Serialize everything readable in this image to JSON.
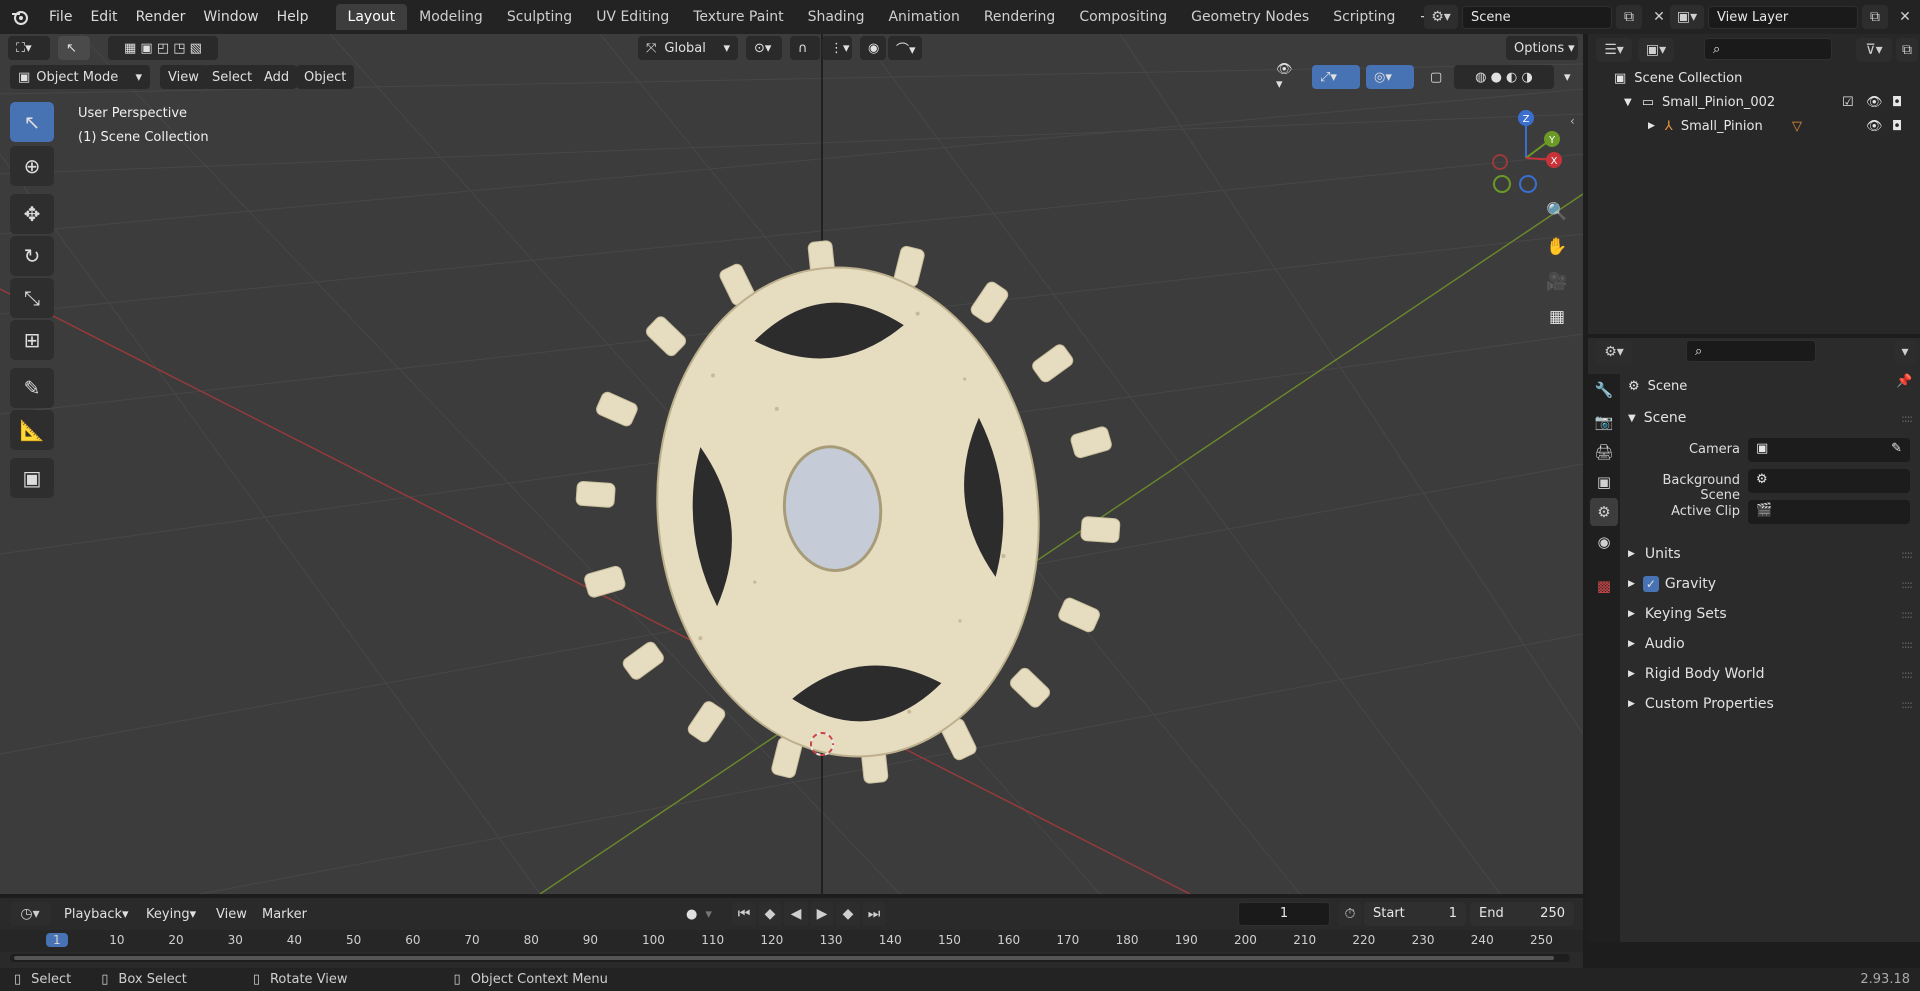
{
  "menu": {
    "logo_icon": "blender-icon",
    "items": [
      "File",
      "Edit",
      "Render",
      "Window",
      "Help"
    ]
  },
  "workspaces": {
    "tabs": [
      "Layout",
      "Modeling",
      "Sculpting",
      "UV Editing",
      "Texture Paint",
      "Shading",
      "Animation",
      "Rendering",
      "Compositing",
      "Geometry Nodes",
      "Scripting"
    ],
    "active": "Layout",
    "add_label": "+"
  },
  "scene_selector": {
    "value": "Scene"
  },
  "view_layer_selector": {
    "value": "View Layer"
  },
  "viewport_header": {
    "mode": "Object Mode",
    "menus": [
      "View",
      "Select",
      "Add",
      "Object"
    ],
    "orientation": "Global",
    "options_label": "Options"
  },
  "viewport": {
    "perspective_label": "User Perspective",
    "collection_label": "(1) Scene Collection",
    "gizmo_axes": [
      "Z",
      "Y",
      "X"
    ],
    "colors": {
      "background": "#3c3c3c",
      "grid": "#474747",
      "x_axis": "#9a3a3a",
      "y_axis": "#6b8a2a",
      "gear_body": "#e6dcc0",
      "gear_hub": "#c6cbd8"
    }
  },
  "outliner": {
    "root": "Scene Collection",
    "items": [
      {
        "name": "Small_Pinion_002",
        "level": 1
      },
      {
        "name": "Small_Pinion",
        "level": 2
      }
    ]
  },
  "properties": {
    "context_label": "Scene",
    "panel_title": "Scene",
    "fields": [
      {
        "label": "Camera"
      },
      {
        "label": "Background Scene"
      },
      {
        "label": "Active Clip"
      }
    ],
    "subpanels": [
      "Units",
      "Gravity",
      "Keying Sets",
      "Audio",
      "Rigid Body World",
      "Custom Properties"
    ],
    "gravity_checked": true
  },
  "timeline": {
    "menus": [
      "Playback",
      "Keying",
      "View",
      "Marker"
    ],
    "current_frame": "1",
    "start_label": "Start",
    "start_value": "1",
    "end_label": "End",
    "end_value": "250",
    "ruler_ticks": [
      "1",
      "10",
      "20",
      "30",
      "40",
      "50",
      "60",
      "70",
      "80",
      "90",
      "100",
      "110",
      "120",
      "130",
      "140",
      "150",
      "160",
      "170",
      "180",
      "190",
      "200",
      "210",
      "220",
      "230",
      "240",
      "250"
    ]
  },
  "statusbar": {
    "items": [
      "Select",
      "Box Select",
      "Rotate View",
      "Object Context Menu"
    ],
    "version": "2.93.18"
  }
}
